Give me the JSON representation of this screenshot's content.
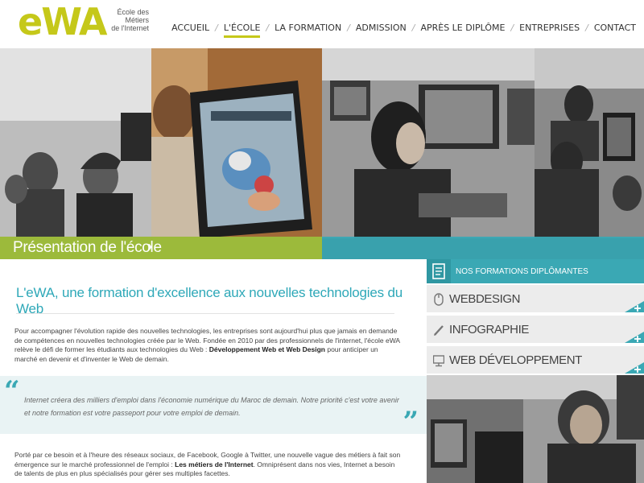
{
  "logo": {
    "name": "eWA",
    "tagline_line1": "École des Métiers",
    "tagline_line2": "de l'Internet"
  },
  "nav": {
    "items": [
      {
        "label": "ACCUEIL",
        "active": false
      },
      {
        "label": "L'ÉCOLE",
        "active": true
      },
      {
        "label": "LA FORMATION",
        "active": false
      },
      {
        "label": "ADMISSION",
        "active": false
      },
      {
        "label": "APRÈS LE DIPLÔME",
        "active": false
      },
      {
        "label": "ENTREPRISES",
        "active": false
      },
      {
        "label": "CONTACT",
        "active": false
      }
    ],
    "separator": "/"
  },
  "hero": {
    "caption": "Présentation de l'école",
    "chevron": "›"
  },
  "main": {
    "title": "L'eWA, une formation d'excellence aux nouvelles technologies du Web",
    "para1_a": "Pour accompagner l'évolution rapide des nouvelles technologies, les entreprises sont aujourd'hui plus que jamais en demande de compétences en nouvelles technologies créée par le Web. Fondée en 2010 par des professionnels de l'internet, l'école eWA relève le défi de former les étudiants aux technologies du Web : ",
    "para1_b": "Développement Web et Web Design",
    "para1_c": " pour anticiper un marché en devenir et d'inventer le Web de demain.",
    "quote": "Internet créera des milliers d'emploi dans l'économie numérique du Maroc de demain. Notre priorité c'est votre avenir et notre formation est votre passeport pour votre emploi de demain.",
    "quote_open": "“",
    "quote_close": "”",
    "para2_a": "Porté par ce besoin et à l'heure des réseaux sociaux, de Facebook, Google à Twitter, une nouvelle vague des métiers à fait son émergence sur le marché professionnel de l'emploi : ",
    "para2_b": "Les métiers de l'Internet",
    "para2_c": ". Omniprésent dans nos vies, Internet a besoin de talents de plus en plus spécialisés pour gérer ses multiples facettes."
  },
  "sidebar": {
    "title": "NOS FORMATIONS DIPLÔMANTES",
    "items": [
      {
        "label": "WEBDESIGN",
        "icon": "mouse-icon"
      },
      {
        "label": "INFOGRAPHIE",
        "icon": "pen-icon"
      },
      {
        "label": "WEB DÉVELOPPEMENT",
        "icon": "monitor-icon"
      }
    ]
  },
  "colors": {
    "brand_green": "#c5c81a",
    "teal": "#3aa8b4",
    "hero_green": "#9cba3b"
  }
}
